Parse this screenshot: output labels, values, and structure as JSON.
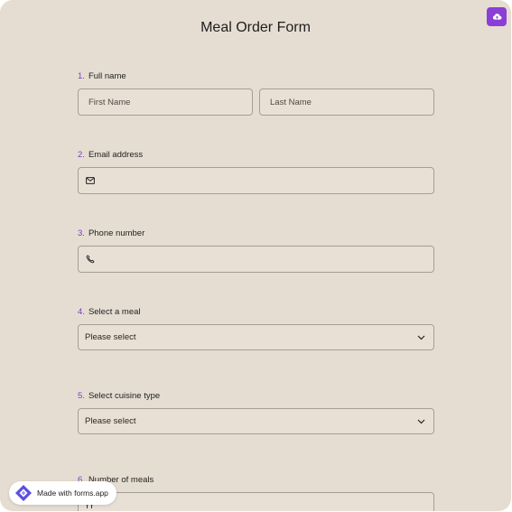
{
  "form": {
    "title": "Meal Order Form"
  },
  "questions": [
    {
      "number": "1.",
      "label": "Full name",
      "first_placeholder": "First Name",
      "last_placeholder": "Last Name"
    },
    {
      "number": "2.",
      "label": "Email address",
      "icon": "envelope-icon"
    },
    {
      "number": "3.",
      "label": "Phone number",
      "icon": "phone-icon"
    },
    {
      "number": "4.",
      "label": "Select a meal",
      "selected": "Please select",
      "icon": "chevron-down-icon"
    },
    {
      "number": "5.",
      "label": "Select cuisine type",
      "selected": "Please select",
      "icon": "chevron-down-icon"
    },
    {
      "number": "6.",
      "label": "Number of meals",
      "icon": "utensils-icon"
    }
  ],
  "badge": {
    "text": "Made with forms.app",
    "icon": "forms-app-logo"
  },
  "toolbar": {
    "upload_icon": "cloud-upload-icon"
  },
  "colors": {
    "background": "#e6ddd2",
    "accent": "#8b3fd6",
    "number": "#7d3cc4",
    "field_border": "#a59e95"
  }
}
